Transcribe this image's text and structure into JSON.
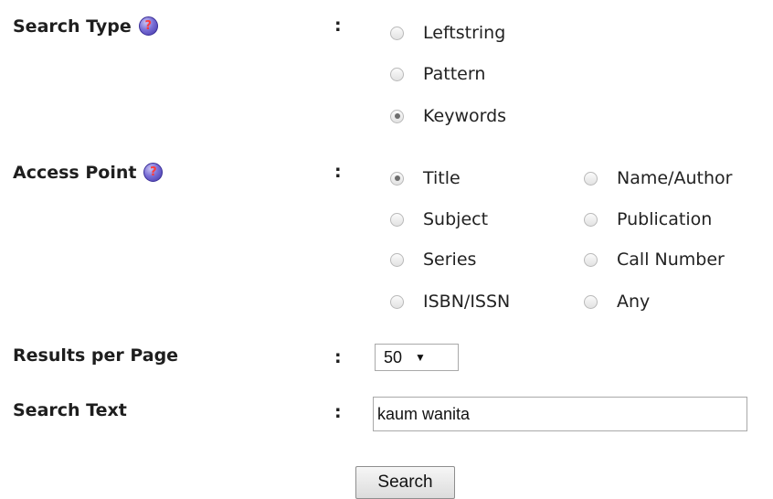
{
  "search_type": {
    "label": "Search Type",
    "help_icon": "question-icon",
    "colon": ":",
    "options": [
      {
        "label": "Leftstring",
        "checked": false
      },
      {
        "label": "Pattern",
        "checked": false
      },
      {
        "label": "Keywords",
        "checked": true
      }
    ]
  },
  "access_point": {
    "label": "Access Point",
    "help_icon": "question-icon",
    "colon": ":",
    "options": [
      {
        "label": "Title",
        "checked": true
      },
      {
        "label": "Name/Author",
        "checked": false
      },
      {
        "label": "Subject",
        "checked": false
      },
      {
        "label": "Publication",
        "checked": false
      },
      {
        "label": "Series",
        "checked": false
      },
      {
        "label": "Call Number",
        "checked": false
      },
      {
        "label": "ISBN/ISSN",
        "checked": false
      },
      {
        "label": "Any",
        "checked": false
      }
    ]
  },
  "results_per_page": {
    "label": "Results per Page",
    "colon": ":",
    "selected": "50",
    "arrow": "▼"
  },
  "search_text": {
    "label": "Search Text",
    "colon": ":",
    "value": "kaum wanita"
  },
  "search_button": {
    "label": "Search"
  },
  "help_glyph": "?"
}
